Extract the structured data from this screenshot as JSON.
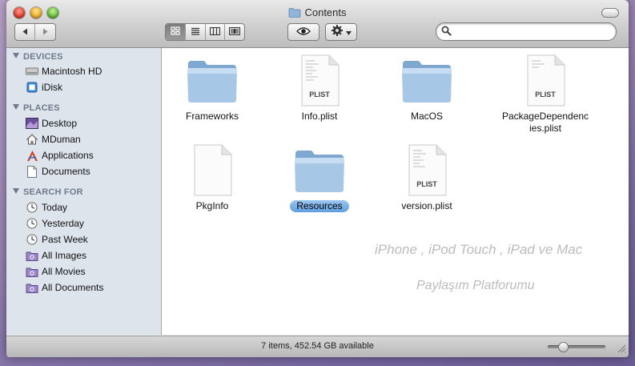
{
  "window": {
    "title": "Contents",
    "folder_icon": "folder-icon"
  },
  "toolbar": {
    "nav": [
      "back-arrow-icon",
      "forward-arrow-icon"
    ],
    "view_modes": [
      "icon-view-icon",
      "list-view-icon",
      "column-view-icon",
      "coverflow-view-icon"
    ],
    "active_view": "icon-view",
    "quicklook_icon": "eye-icon",
    "action_icon": "gear-icon",
    "search": {
      "value": "",
      "placeholder": ""
    }
  },
  "sidebar": {
    "devices": {
      "heading": "DEVICES",
      "items": [
        {
          "label": "Macintosh HD",
          "icon": "hard-drive-icon"
        },
        {
          "label": "iDisk",
          "icon": "idisk-icon"
        }
      ]
    },
    "places": {
      "heading": "PLACES",
      "items": [
        {
          "label": "Desktop",
          "icon": "desktop-icon"
        },
        {
          "label": "MDuman",
          "icon": "home-icon"
        },
        {
          "label": "Applications",
          "icon": "applications-icon"
        },
        {
          "label": "Documents",
          "icon": "documents-icon"
        }
      ]
    },
    "search_for": {
      "heading": "SEARCH FOR",
      "items": [
        {
          "label": "Today",
          "icon": "clock-icon"
        },
        {
          "label": "Yesterday",
          "icon": "clock-icon"
        },
        {
          "label": "Past Week",
          "icon": "clock-icon"
        },
        {
          "label": "All Images",
          "icon": "smart-folder-icon"
        },
        {
          "label": "All Movies",
          "icon": "smart-folder-icon"
        },
        {
          "label": "All Documents",
          "icon": "smart-folder-icon"
        }
      ]
    }
  },
  "files": [
    {
      "name": "Frameworks",
      "kind": "folder",
      "selected": false
    },
    {
      "name": "Info.plist",
      "kind": "plist",
      "badge": "PLIST",
      "selected": false
    },
    {
      "name": "MacOS",
      "kind": "folder",
      "selected": false
    },
    {
      "name": "PackageDependencies.plist",
      "name_line1": "PackageDependenc",
      "name_line2": "ies.plist",
      "kind": "plist",
      "badge": "PLIST",
      "selected": false
    },
    {
      "name": "PkgInfo",
      "kind": "document",
      "selected": false
    },
    {
      "name": "Resources",
      "kind": "folder",
      "selected": true
    },
    {
      "name": "version.plist",
      "kind": "plist",
      "badge": "PLIST",
      "selected": false
    }
  ],
  "watermark": {
    "line1": "iPhone , iPod Touch , iPad ve Mac",
    "line2": "Paylaşım Platforumu"
  },
  "status": {
    "text": "7 items, 452.54 GB available",
    "icon_size_fraction": 0.2
  },
  "colors": {
    "selection": "#7fb3e8",
    "sidebar_bg": "#dee4ec",
    "folder_blue": "#8fb6d8"
  }
}
